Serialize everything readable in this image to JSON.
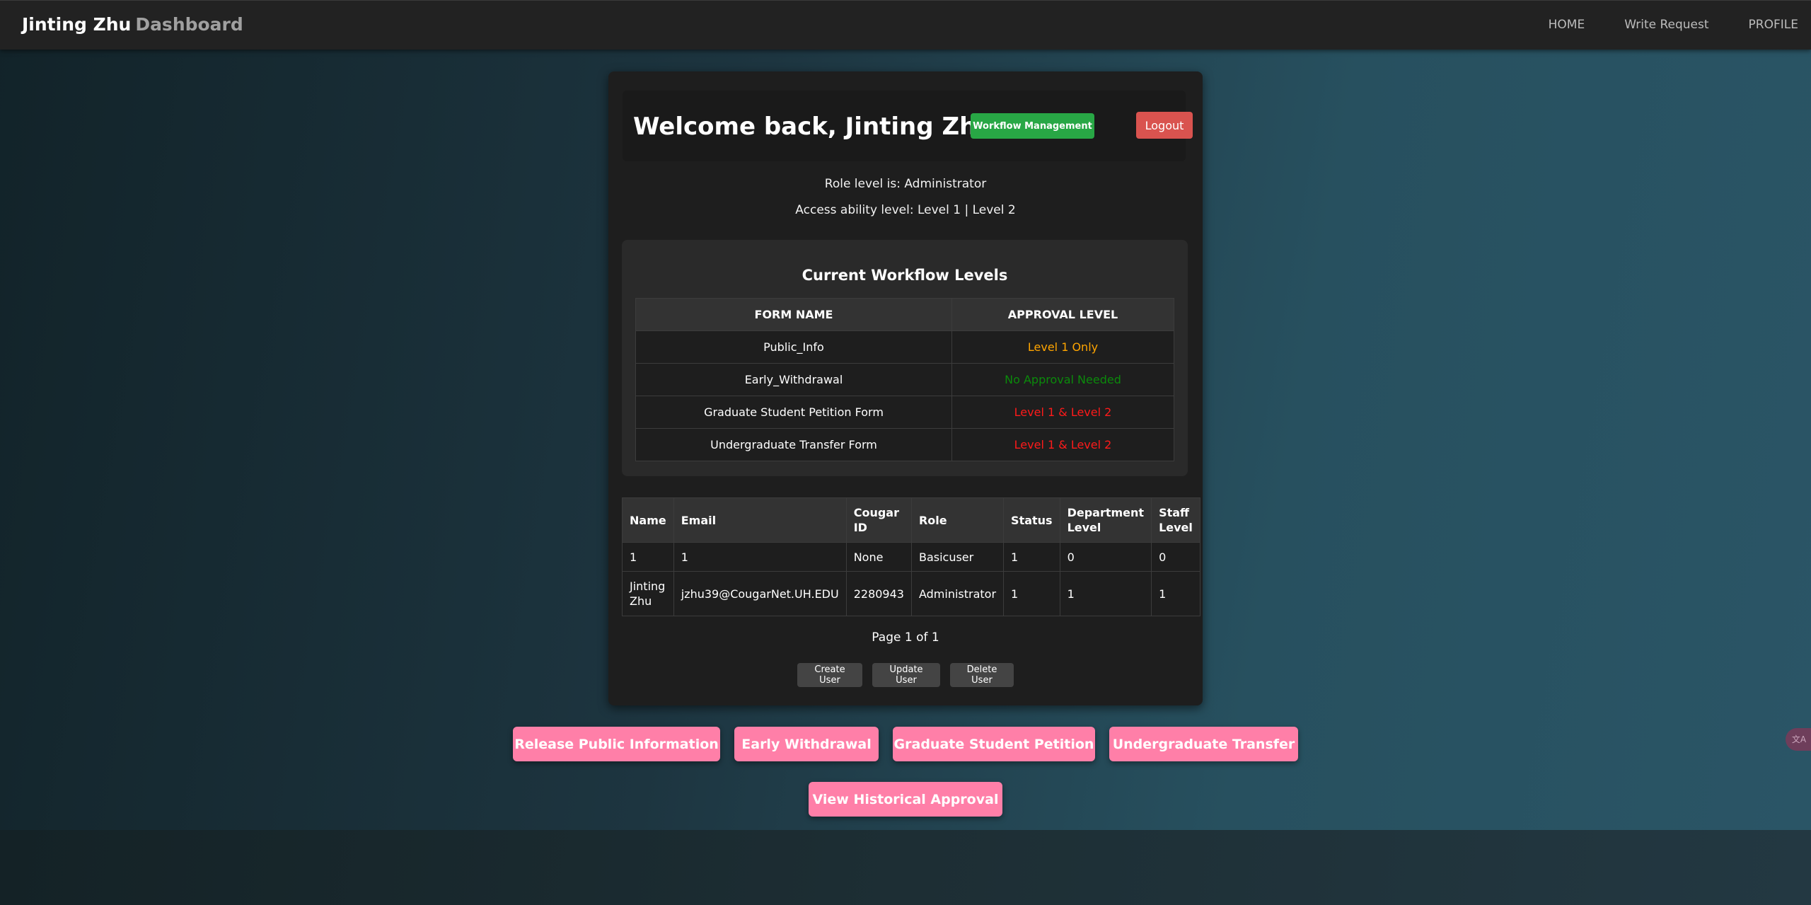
{
  "nav": {
    "brand_name": "Jinting Zhu",
    "brand_suffix": "Dashboard",
    "links": [
      "HOME",
      "Write Request",
      "PROFILE"
    ]
  },
  "welcome": {
    "title": "Welcome back, Jinting Zhu",
    "workflow_button": "Workflow Management",
    "logout_button": "Logout"
  },
  "role_line": "Role level is: Administrator",
  "access_line": "Access ability level: Level 1 | Level 2",
  "workflow": {
    "title": "Current Workflow Levels",
    "headers": [
      "FORM NAME",
      "APPROVAL LEVEL"
    ],
    "rows": [
      {
        "form": "Public_Info",
        "level": "Level 1 Only",
        "color": "#ffa500"
      },
      {
        "form": "Early_Withdrawal",
        "level": "No Approval Needed",
        "color": "#0b8a0b"
      },
      {
        "form": "Graduate Student Petition Form",
        "level": "Level 1 & Level 2",
        "color": "#ff1a1a"
      },
      {
        "form": "Undergraduate Transfer Form",
        "level": "Level 1 & Level 2",
        "color": "#ff1a1a"
      }
    ]
  },
  "users": {
    "headers": [
      "Name",
      "Email",
      "Cougar ID",
      "Role",
      "Status",
      "Department Level",
      "Staff Level"
    ],
    "rows": [
      [
        "1",
        "1",
        "None",
        "Basicuser",
        "1",
        "0",
        "0"
      ],
      [
        "Jinting Zhu",
        "jzhu39@CougarNet.UH.EDU",
        "2280943",
        "Administrator",
        "1",
        "1",
        "1"
      ]
    ]
  },
  "pagination": "Page 1 of 1",
  "user_actions": [
    "Create User",
    "Update User",
    "Delete User"
  ],
  "form_buttons": [
    "Release Public Information",
    "Early Withdrawal",
    "Graduate Student Petition",
    "Undergraduate Transfer"
  ],
  "history_button": "View Historical Approval",
  "colors": {
    "workflow_green": "#28a745",
    "logout_red": "#d9534f",
    "action_pink": "#ff7fa8"
  }
}
